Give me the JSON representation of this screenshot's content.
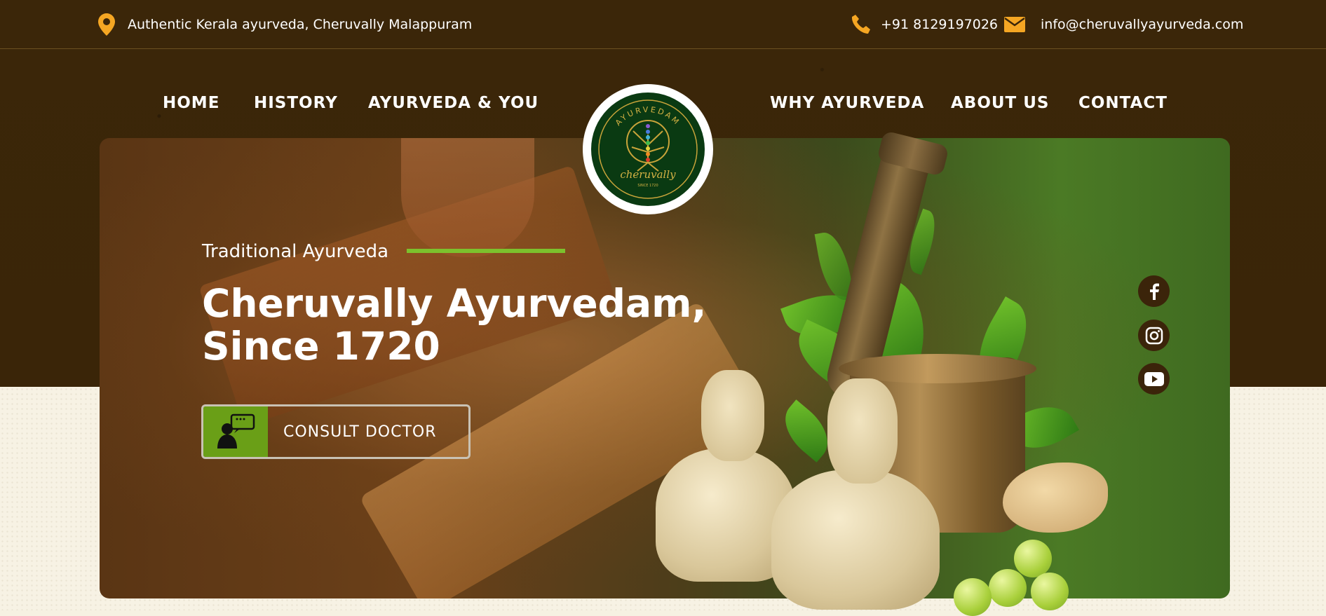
{
  "topbar": {
    "address": "Authentic Kerala ayurveda, Cheruvally Malappuram",
    "phone": "+91 8129197026",
    "email": "info@cheruvallyayurveda.com",
    "icons": [
      "map-pin-icon",
      "phone-icon",
      "mail-icon"
    ]
  },
  "nav": {
    "left": [
      "HOME",
      "HISTORY",
      "AYURVEDA & YOU"
    ],
    "right": [
      "WHY AYURVEDA",
      "ABOUT US",
      "CONTACT"
    ]
  },
  "logo": {
    "top_text": "AYURVEDAM",
    "script_text": "cheruvally",
    "small_text": "SINCE 1720"
  },
  "hero": {
    "kicker": "Traditional Ayurveda",
    "title_line1": "Cheruvally Ayurvedam,",
    "title_line2": "Since 1720",
    "cta_label": "CONSULT DOCTOR"
  },
  "social": [
    "facebook-icon",
    "instagram-icon",
    "youtube-icon"
  ],
  "colors": {
    "dark_brown": "#3b2609",
    "accent_orange": "#f5a623",
    "accent_green": "#7cc12d",
    "button_green": "#6a9f17",
    "cream": "#f7f2e4"
  }
}
